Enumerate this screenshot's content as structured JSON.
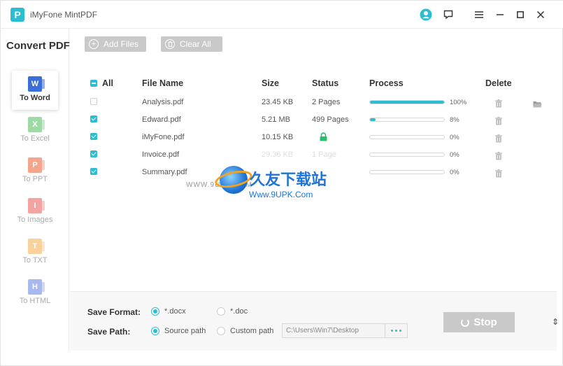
{
  "app": {
    "title": "iMyFone MintPDF",
    "logo_letter": "P"
  },
  "sidebar": {
    "title": "Convert PDF",
    "items": [
      {
        "label": "To Word",
        "icon": "W",
        "color": "#3a6fd8",
        "active": true
      },
      {
        "label": "To Excel",
        "icon": "X",
        "color": "#9fd9a5",
        "active": false
      },
      {
        "label": "To PPT",
        "icon": "P",
        "color": "#f4a58c",
        "active": false
      },
      {
        "label": "To Images",
        "icon": "I",
        "color": "#f4a3a3",
        "active": false
      },
      {
        "label": "To TXT",
        "icon": "T",
        "color": "#f8d29a",
        "active": false
      },
      {
        "label": "To HTML",
        "icon": "H",
        "color": "#a9b8ef",
        "active": false
      }
    ]
  },
  "toolbar": {
    "add_files": "Add Files",
    "clear_all": "Clear All"
  },
  "table": {
    "headers": {
      "all": "All",
      "file_name": "File Name",
      "size": "Size",
      "status": "Status",
      "process": "Process",
      "delete": "Delete"
    },
    "rows": [
      {
        "checked": false,
        "name": "Analysis.pdf",
        "size": "23.45 KB",
        "status": "2 Pages",
        "progress": 100,
        "pct": "100%",
        "open_folder": true,
        "locked": false,
        "faded": false
      },
      {
        "checked": true,
        "name": "Edward.pdf",
        "size": "5.21 MB",
        "status": "499 Pages",
        "progress": 8,
        "pct": "8%",
        "open_folder": false,
        "locked": false,
        "faded": false
      },
      {
        "checked": true,
        "name": "iMyFone.pdf",
        "size": "10.15 KB",
        "status": "",
        "progress": 0,
        "pct": "0%",
        "open_folder": false,
        "locked": true,
        "faded": false
      },
      {
        "checked": true,
        "name": "Invoice.pdf",
        "size": "29.36 KB",
        "status": "1 Page",
        "progress": 0,
        "pct": "0%",
        "open_folder": false,
        "locked": false,
        "faded": true
      },
      {
        "checked": true,
        "name": "Summary.pdf",
        "size": "",
        "status": "",
        "progress": 0,
        "pct": "0%",
        "open_folder": false,
        "locked": false,
        "faded": false
      }
    ]
  },
  "save": {
    "format_label": "Save Format:",
    "format_options": [
      "*.docx",
      "*.doc"
    ],
    "format_selected": "*.docx",
    "path_label": "Save Path:",
    "path_options": [
      "Source path",
      "Custom path"
    ],
    "path_selected": "Source path",
    "custom_path_value": "C:\\Users\\Win7\\Desktop"
  },
  "stop_button": "Stop",
  "watermark": {
    "title": "久友下载站",
    "url": "Www.9UPK.Com",
    "www": "WWW.9UPK.COM"
  },
  "accent_color": "#2bbdd1"
}
